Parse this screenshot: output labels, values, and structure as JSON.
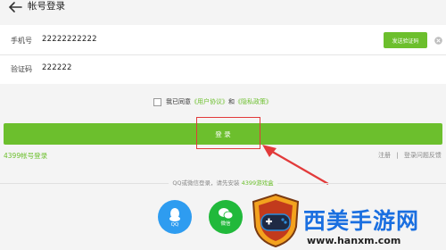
{
  "header": {
    "title": "帐号登录",
    "back_icon": "back-arrow-icon"
  },
  "form": {
    "phone_label": "手机号",
    "phone_value": "22222222222",
    "sms_button": "发送验证码",
    "code_label": "验证码",
    "code_value": "222222"
  },
  "agreement": {
    "prefix": "我已同意",
    "user_agreement": "《用户协议》",
    "and": "和",
    "privacy_policy": "《隐私政策》",
    "checked": false
  },
  "login": {
    "label": "登 录"
  },
  "links": {
    "account_login": "4399帐号登录",
    "register": "注册",
    "separator": "|",
    "problem": "登录问题反馈"
  },
  "social": {
    "note": "QQ或微信登录，请先安装",
    "note_link": "4399游戏盒",
    "qq_label": "QQ",
    "wechat_label": "微信"
  },
  "watermark": {
    "text": "西美手游网",
    "url": "www.hanxm.com"
  },
  "colors": {
    "accent": "#6cbf2d",
    "highlight": "#e23a3a",
    "qq": "#2e9cf0",
    "wechat": "#21b93b"
  }
}
